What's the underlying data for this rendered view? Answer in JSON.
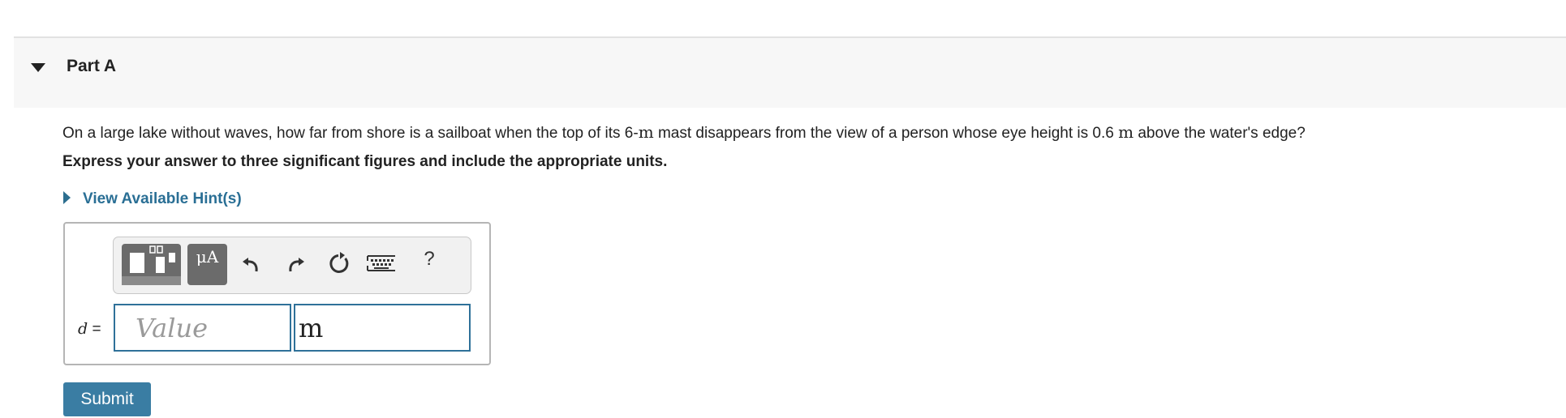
{
  "part": {
    "title": "Part A"
  },
  "question": {
    "text_1": "On a large lake without waves, how far from shore is a sailboat when the top of its 6-",
    "unit_1": "m",
    "text_2": " mast disappears from the view of a person whose eye height is 0.6 ",
    "unit_2": "m",
    "text_3": " above the water's edge?"
  },
  "instruction": "Express your answer to three significant figures and include the appropriate units.",
  "hint": {
    "label": "View Available Hint(s)"
  },
  "toolbar": {
    "templates_icon": "templates-icon",
    "symbols_label": "μA",
    "undo_icon": "undo-icon",
    "redo_icon": "redo-icon",
    "reset_icon": "reset-icon",
    "keyboard_icon": "keyboard-icon",
    "help_label": "?"
  },
  "answer": {
    "variable": "d",
    "equals": "=",
    "value_placeholder": "Value",
    "value": "",
    "unit_value": "m"
  },
  "submit": {
    "label": "Submit"
  },
  "colors": {
    "link": "#2a6f95",
    "accent": "#3a7da3",
    "input_border": "#2f7199",
    "toolbar_button": "#6b6b6b"
  }
}
